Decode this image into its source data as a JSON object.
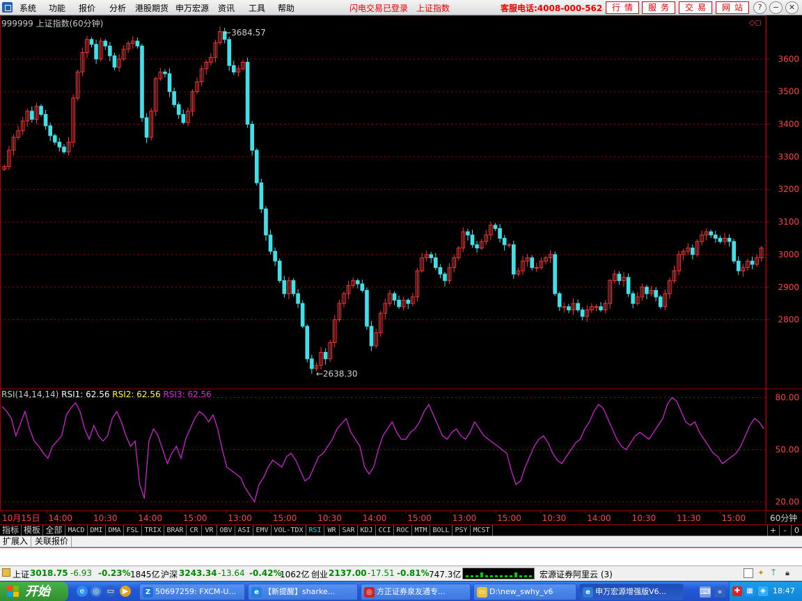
{
  "menu": {
    "items": [
      "系统",
      "功能",
      "报价",
      "分析",
      "港股期货",
      "申万宏源",
      "资讯",
      "工具",
      "帮助"
    ],
    "flash_status": "闪电交易已登录",
    "current_index": "上证指数",
    "hotline": "客服电话:4008-000-562",
    "buttons": [
      "行情",
      "服务",
      "交易",
      "网站"
    ],
    "window_controls": [
      "?",
      "−",
      "❐",
      "✕"
    ]
  },
  "chart": {
    "title": "999999 上证指数(60分钟)",
    "high_label": "3684.57",
    "low_label": "2638.30",
    "colors": {
      "up": "#ff3232",
      "down": "#40e0e8",
      "rsi": "#e020e0",
      "grid": "#a00000",
      "axis_label": "#ff4040"
    }
  },
  "rsi": {
    "params": "RSI(14,14,14)",
    "rsi1_label": "RSI1: 62.56",
    "rsi2_label": "RSI2: 62.56",
    "rsi3_label": "RSI3: 62.56"
  },
  "chart_data": [
    {
      "type": "candlestick",
      "title": "999999 上证指数(60分钟)",
      "price_ticks": [
        2800,
        2900,
        3000,
        3100,
        3200,
        3300,
        3400,
        3500,
        3600
      ],
      "ylim": [
        2590,
        3700
      ],
      "annotations": [
        {
          "label": "3684.57",
          "value": 3684.57
        },
        {
          "label": "2638.30",
          "value": 2638.3
        }
      ],
      "time_ticks": [
        "10月15日",
        "14:00",
        "10:30",
        "14:00",
        "15:00",
        "13:00",
        "15:00",
        "10:30",
        "14:00",
        "15:00",
        "13:00",
        "15:00",
        "10:30",
        "14:00",
        "10:30",
        "11:30",
        "15:00"
      ],
      "period_label": "60分钟",
      "closes": [
        3270,
        3320,
        3360,
        3380,
        3410,
        3440,
        3415,
        3455,
        3430,
        3395,
        3365,
        3345,
        3330,
        3315,
        3345,
        3480,
        3560,
        3620,
        3660,
        3645,
        3600,
        3655,
        3640,
        3610,
        3575,
        3600,
        3630,
        3648,
        3655,
        3640,
        3420,
        3360,
        3440,
        3540,
        3560,
        3555,
        3500,
        3460,
        3430,
        3405,
        3440,
        3500,
        3530,
        3570,
        3590,
        3605,
        3650,
        3684,
        3660,
        3580,
        3560,
        3570,
        3590,
        3400,
        3320,
        3220,
        3140,
        3060,
        3010,
        2980,
        2920,
        2880,
        2920,
        2880,
        2850,
        2780,
        2680,
        2650,
        2660,
        2700,
        2680,
        2730,
        2800,
        2850,
        2880,
        2905,
        2920,
        2910,
        2890,
        2780,
        2720,
        2760,
        2820,
        2850,
        2880,
        2860,
        2840,
        2860,
        2850,
        2870,
        2950,
        2990,
        3000,
        2990,
        2960,
        2940,
        2920,
        2960,
        2990,
        3020,
        3070,
        3060,
        3030,
        3020,
        3040,
        3060,
        3090,
        3080,
        3050,
        3030,
        3030,
        2940,
        2950,
        2980,
        2990,
        2960,
        2960,
        2980,
        2990,
        3000,
        2880,
        2840,
        2840,
        2830,
        2850,
        2830,
        2810,
        2830,
        2840,
        2840,
        2830,
        2850,
        2920,
        2940,
        2920,
        2930,
        2880,
        2850,
        2870,
        2900,
        2880,
        2890,
        2870,
        2840,
        2880,
        2920,
        2950,
        3000,
        3010,
        3020,
        3000,
        3040,
        3060,
        3070,
        3060,
        3050,
        3040,
        3050,
        3040,
        2980,
        2950,
        2960,
        2980,
        2970,
        2990,
        3020
      ]
    },
    {
      "type": "line",
      "title": "RSI(14,14,14)",
      "y_ticks": [
        20.0,
        50.0,
        80.0
      ],
      "ylim": [
        15,
        85
      ],
      "series": [
        {
          "name": "RSI1",
          "values": [
            75,
            72,
            68,
            58,
            65,
            72,
            62,
            55,
            52,
            48,
            45,
            52,
            55,
            58,
            70,
            74,
            77,
            72,
            62,
            56,
            64,
            58,
            55,
            58,
            68,
            72,
            66,
            58,
            52,
            55,
            30,
            22,
            55,
            62,
            58,
            50,
            42,
            48,
            52,
            45,
            56,
            62,
            68,
            72,
            70,
            66,
            70,
            62,
            50,
            40,
            38,
            36,
            34,
            28,
            24,
            20,
            30,
            34,
            40,
            44,
            42,
            40,
            46,
            48,
            44,
            38,
            32,
            34,
            40,
            46,
            48,
            52,
            56,
            62,
            65,
            68,
            60,
            56,
            52,
            40,
            36,
            40,
            50,
            58,
            62,
            66,
            60,
            56,
            56,
            60,
            62,
            66,
            72,
            76,
            70,
            64,
            58,
            56,
            60,
            62,
            58,
            56,
            60,
            66,
            62,
            58,
            56,
            54,
            52,
            50,
            48,
            38,
            30,
            32,
            40,
            46,
            52,
            56,
            58,
            54,
            48,
            44,
            42,
            46,
            50,
            54,
            56,
            62,
            66,
            72,
            76,
            74,
            68,
            62,
            56,
            52,
            50,
            54,
            58,
            60,
            58,
            56,
            60,
            64,
            68,
            76,
            80,
            78,
            72,
            66,
            64,
            66,
            60,
            56,
            52,
            48,
            46,
            42,
            44,
            46,
            48,
            52,
            58,
            64,
            68,
            66,
            62
          ]
        }
      ]
    }
  ],
  "tabs": {
    "left": [
      "指标",
      "模板",
      "全部"
    ],
    "indicators": [
      "MACD",
      "DMI",
      "DMA",
      "FSL",
      "TRIX",
      "BRAR",
      "CR",
      "VR",
      "OBV",
      "ASI",
      "EMV",
      "VOL-TDX",
      "RSI",
      "WR",
      "SAR",
      "KDJ",
      "CCI",
      "ROC",
      "MTM",
      "BOLL",
      "PSY",
      "MCST"
    ],
    "active": "RSI",
    "side_controls": [
      "+",
      "-",
      "0"
    ]
  },
  "ext_tabs": [
    "扩展入",
    "关联报价"
  ],
  "status": {
    "sh_label": "上证",
    "sh_value": "3018.75",
    "sh_change": "-6.93",
    "sh_pct": "-0.23%",
    "sh_amount": "1845亿",
    "hs_label": "沪深",
    "hs_value": "3243.34",
    "hs_change": "-13.64",
    "hs_pct": "-0.42%",
    "hs_amount": "1062亿",
    "cy_label": "创业",
    "cy_value": "2137.00",
    "cy_change": "-17.51",
    "cy_pct": "-0.81%",
    "cy_amount": "747.3亿",
    "server": "宏源证券阿里云 (3)"
  },
  "taskbar": {
    "start_label": "开始",
    "items": [
      {
        "label": "50697259: FXCM-U...",
        "icon": "Z",
        "color": "#1e6fe0"
      },
      {
        "label": "【新提醒】sharke...",
        "icon": "e",
        "color": "#2080e0"
      },
      {
        "label": "方正证券泉友通专...",
        "icon": "◎",
        "color": "#d02020"
      },
      {
        "label": "D:\\new_swhy_v6",
        "icon": "▭",
        "color": "#e8c040"
      },
      {
        "label": "申万宏源增强版V6...",
        "icon": "e",
        "color": "#2a7de0"
      }
    ],
    "clock": "18:47"
  }
}
